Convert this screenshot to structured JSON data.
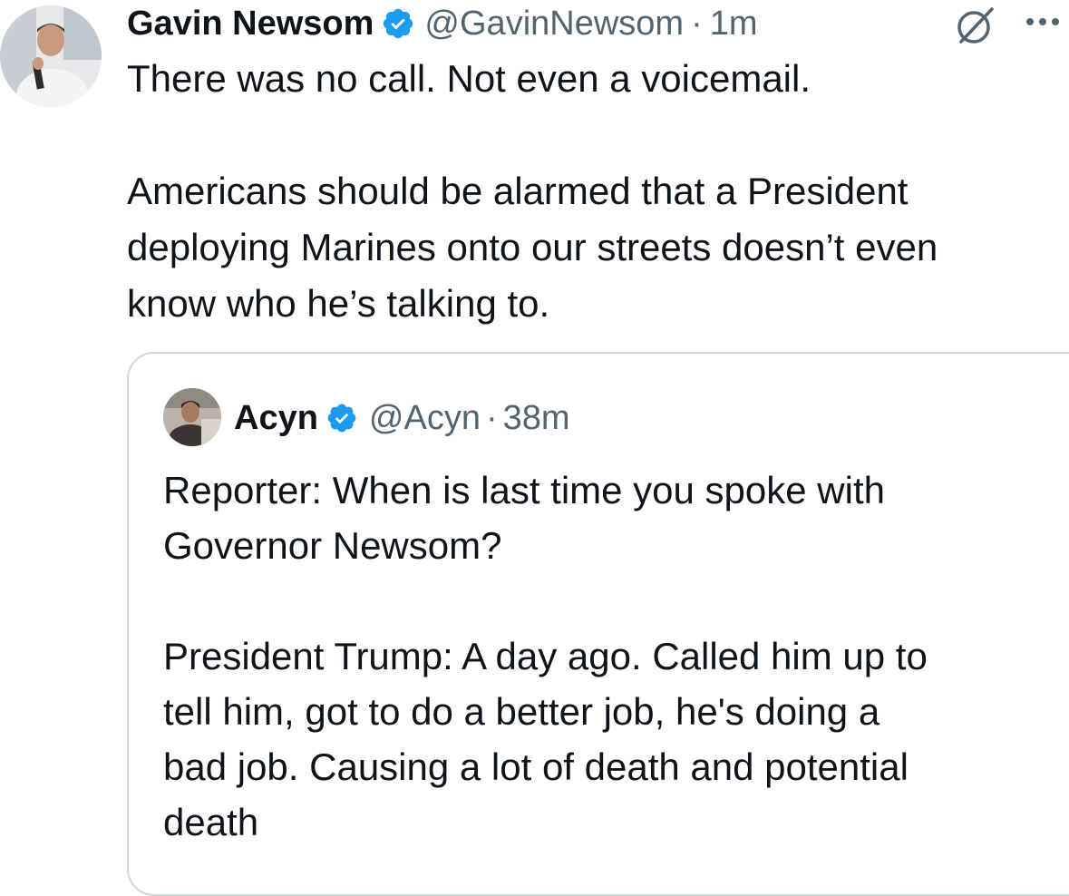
{
  "tweet": {
    "display_name": "Gavin Newsom",
    "handle": "@GavinNewsom",
    "separator": "·",
    "time": "1m",
    "text_lines": [
      "There was no call. Not even a voicemail.",
      "",
      "Americans should be alarmed that a President",
      "deploying Marines onto our streets doesn’t even",
      "know who he’s talking to."
    ],
    "icons": {
      "verified": "verified-badge-icon",
      "grok": "grok-icon",
      "more": "more-options-icon"
    }
  },
  "quote": {
    "display_name": "Acyn",
    "handle": "@Acyn",
    "separator": "·",
    "time": "38m",
    "text_lines": [
      "Reporter: When is last time you spoke with",
      "Governor Newsom?",
      "",
      "President Trump: A day ago. Called him up to",
      "tell him, got to do a better job, he's doing a",
      "bad job. Causing a lot of death and potential",
      "death"
    ]
  },
  "colors": {
    "text_primary": "#0f1419",
    "text_secondary": "#536471",
    "verified_blue": "#1d9bf0",
    "border": "#cfd9de"
  }
}
